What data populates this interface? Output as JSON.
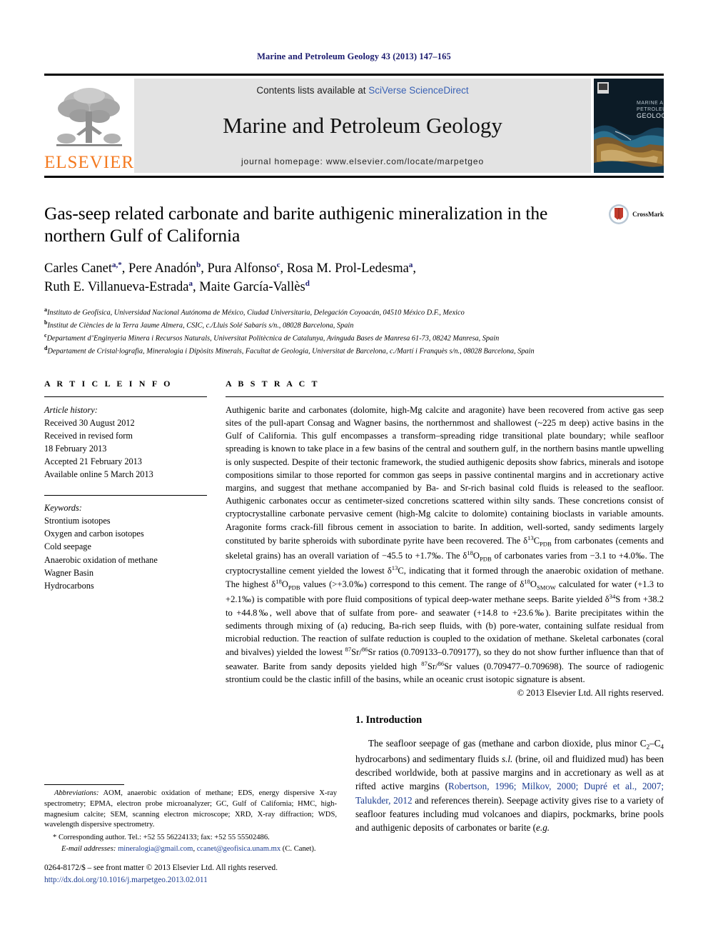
{
  "running_head": "Marine and Petroleum Geology 43 (2013) 147–165",
  "masthead": {
    "contents_prefix": "Contents lists available at ",
    "sciencedirect": "SciVerse ScienceDirect",
    "journal_title": "Marine and Petroleum Geology",
    "homepage": "journal homepage: www.elsevier.com/locate/marpetgeo",
    "publisher_logo_text": "ELSEVIER",
    "cover_title_line1": "MARINE AND",
    "cover_title_line2": "PETROLEUM",
    "cover_title_line3": "GEOLOGY"
  },
  "article": {
    "title": "Gas-seep related carbonate and barite authigenic mineralization in the northern Gulf of California",
    "crossmark_label": "CrossMark",
    "authors_line1": "Carles Canet",
    "authors": [
      {
        "name": "Carles Canet",
        "sup": "a,*"
      },
      {
        "name": "Pere Anadón",
        "sup": "b"
      },
      {
        "name": "Pura Alfonso",
        "sup": "c"
      },
      {
        "name": "Rosa M. Prol-Ledesma",
        "sup": "a"
      },
      {
        "name": "Ruth E. Villanueva-Estrada",
        "sup": "a"
      },
      {
        "name": "Maite García-Vallès",
        "sup": "d"
      }
    ],
    "affiliations": [
      {
        "label": "a",
        "text": "Instituto de Geofísica, Universidad Nacional Autónoma de México, Ciudad Universitaria, Delegación Coyoacán, 04510 México D.F., Mexico"
      },
      {
        "label": "b",
        "text": "Institut de Ciències de la Terra Jaume Almera, CSIC, c./Lluis Solé Sabarís s/n., 08028 Barcelona, Spain"
      },
      {
        "label": "c",
        "text": "Departament d’Enginyeria Minera i Recursos Naturals, Universitat Politècnica de Catalunya, Avinguda Bases de Manresa 61-73, 08242 Manresa, Spain"
      },
      {
        "label": "d",
        "text": "Departament de Cristal·lografia, Mineralogia i Dipòsits Minerals, Facultat de Geologia, Universitat de Barcelona, c./Martí i Franquès s/n., 08028 Barcelona, Spain"
      }
    ]
  },
  "article_info": {
    "heading": "A R T I C L E  I N F O",
    "history_label": "Article history:",
    "history": [
      "Received 30 August 2012",
      "Received in revised form",
      "18 February 2013",
      "Accepted 21 February 2013",
      "Available online 5 March 2013"
    ],
    "keywords_label": "Keywords:",
    "keywords": [
      "Strontium isotopes",
      "Oxygen and carbon isotopes",
      "Cold seepage",
      "Anaerobic oxidation of methane",
      "Wagner Basin",
      "Hydrocarbons"
    ]
  },
  "abstract": {
    "heading": "A B S T R A C T",
    "text_part1": "Authigenic barite and carbonates (dolomite, high-Mg calcite and aragonite) have been recovered from active gas seep sites of the pull-apart Consag and Wagner basins, the northernmost and shallowest (~225 m deep) active basins in the Gulf of California. This gulf encompasses a transform–spreading ridge transitional plate boundary; while seafloor spreading is known to take place in a few basins of the central and southern gulf, in the northern basins mantle upwelling is only suspected. Despite of their tectonic framework, the studied authigenic deposits show fabrics, minerals and isotope compositions similar to those reported for common gas seeps in passive continental margins and in accretionary active margins, and suggest that methane accompanied by Ba- and Sr-rich basinal cold fluids is released to the seafloor. Authigenic carbonates occur as centimeter-sized concretions scattered within silty sands. These concretions consist of cryptocrystalline carbonate pervasive cement (high-Mg calcite to dolomite) containing bioclasts in variable amounts. Aragonite forms crack-fill fibrous cement in association to barite. In addition, well-sorted, sandy sediments largely constituted by barite spheroids with subordinate pyrite have been recovered. The δ",
    "d13C_sup": "13",
    "d13C_rest": "C",
    "d13C_sub": "PDB",
    "text_part2": " from carbonates (cements and skeletal grains) has an overall variation of −45.5 to +1.7‰. The δ",
    "d18O_sup": "18",
    "d18O_rest": "O",
    "d18O_sub": "PDB",
    "text_part3": " of carbonates varies from −3.1 to +4.0‰. The cryptocrystalline cement yielded the lowest δ",
    "d13c2_sup": "13",
    "d13c2_rest": "C",
    "text_part4": ", indicating that it formed through the anaerobic oxidation of methane. The highest δ",
    "d18o2_sup": "18",
    "d18o2_rest": "O",
    "d18o2_sub": "PDB",
    "text_part5": " values (>+3.0‰) correspond to this cement. The range of δ",
    "d18o3_sup": "18",
    "d18o3_rest": "O",
    "d18o3_sub": "SMOW",
    "text_part6": " calculated for water (+1.3 to +2.1‰) is compatible with pore fluid compositions of typical deep-water methane seeps. Barite yielded δ",
    "d34s_sup": "34",
    "d34s_rest": "S",
    "text_part7": " from +38.2 to +44.8‰, well above that of sulfate from pore- and seawater (+14.8 to +23.6‰). Barite precipitates within the sediments through mixing of (a) reducing, Ba-rich seep fluids, with (b) pore-water, containing sulfate residual from microbial reduction. The reaction of sulfate reduction is coupled to the oxidation of methane. Skeletal carbonates (coral and bivalves) yielded the lowest ",
    "sr87_sup": "87",
    "sr87_rest": "Sr/",
    "sr86_sup": "86",
    "sr86_rest": "Sr",
    "text_part8": " ratios (0.709133–0.709177), so they do not show further influence than that of seawater. Barite from sandy deposits yielded high ",
    "sr87b_sup": "87",
    "sr87b_rest": "Sr/",
    "sr86b_sup": "86",
    "sr86b_rest": "Sr",
    "text_part9": " values (0.709477–0.709698). The source of radiogenic strontium could be the clastic infill of the basins, while an oceanic crust isotopic signature is absent.",
    "copyright": "© 2013 Elsevier Ltd. All rights reserved."
  },
  "introduction": {
    "heading": "1. Introduction",
    "para_a": "The seafloor seepage of gas (methane and carbon dioxide, plus minor C",
    "sub_2": "2",
    "dash": "–C",
    "sub_4": "4",
    "para_b": " hydrocarbons) and sedimentary fluids ",
    "si": "s.l.",
    "para_c": " (brine, oil and fluidized mud) has been described worldwide, both at passive margins and in accretionary as well as at rifted active margins (",
    "citations": "Robertson, 1996; Milkov, 2000; Dupré et al., 2007; Talukder, 2012",
    "para_d": " and references therein). Seepage activity gives rise to a variety of seafloor features including mud volcanoes and diapirs, pockmarks, brine pools and authigenic deposits of carbonates or barite (",
    "eg": "e.g.",
    "para_e": ""
  },
  "footnotes": {
    "abbrev_label": "Abbreviations:",
    "abbrev_text": " AOM, anaerobic oxidation of methane; EDS, energy dispersive X-ray spectrometry; EPMA, electron probe microanalyzer; GC, Gulf of California; HMC, high-magnesium calcite; SEM, scanning electron microscope; XRD, X-ray diffraction; WDS, wavelength dispersive spectrometry.",
    "corresponding": "* Corresponding author. Tel.: +52 55 56224133; fax: +52 55 55502486.",
    "email_label": "E-mail addresses:",
    "email_1": "mineralogia@gmail.com",
    "email_sep": ", ",
    "email_2": "ccanet@geofisica.unam.mx",
    "email_suffix": " (C. Canet).",
    "issn_line": "0264-8172/$ – see front matter © 2013 Elsevier Ltd. All rights reserved.",
    "doi": "http://dx.doi.org/10.1016/j.marpetgeo.2013.02.011"
  },
  "colors": {
    "link_blue": "#1a3a8f",
    "sciencedirect_blue": "#3a62b5",
    "elsevier_orange": "#F47A20",
    "masthead_gray": "#e3e3e3"
  }
}
